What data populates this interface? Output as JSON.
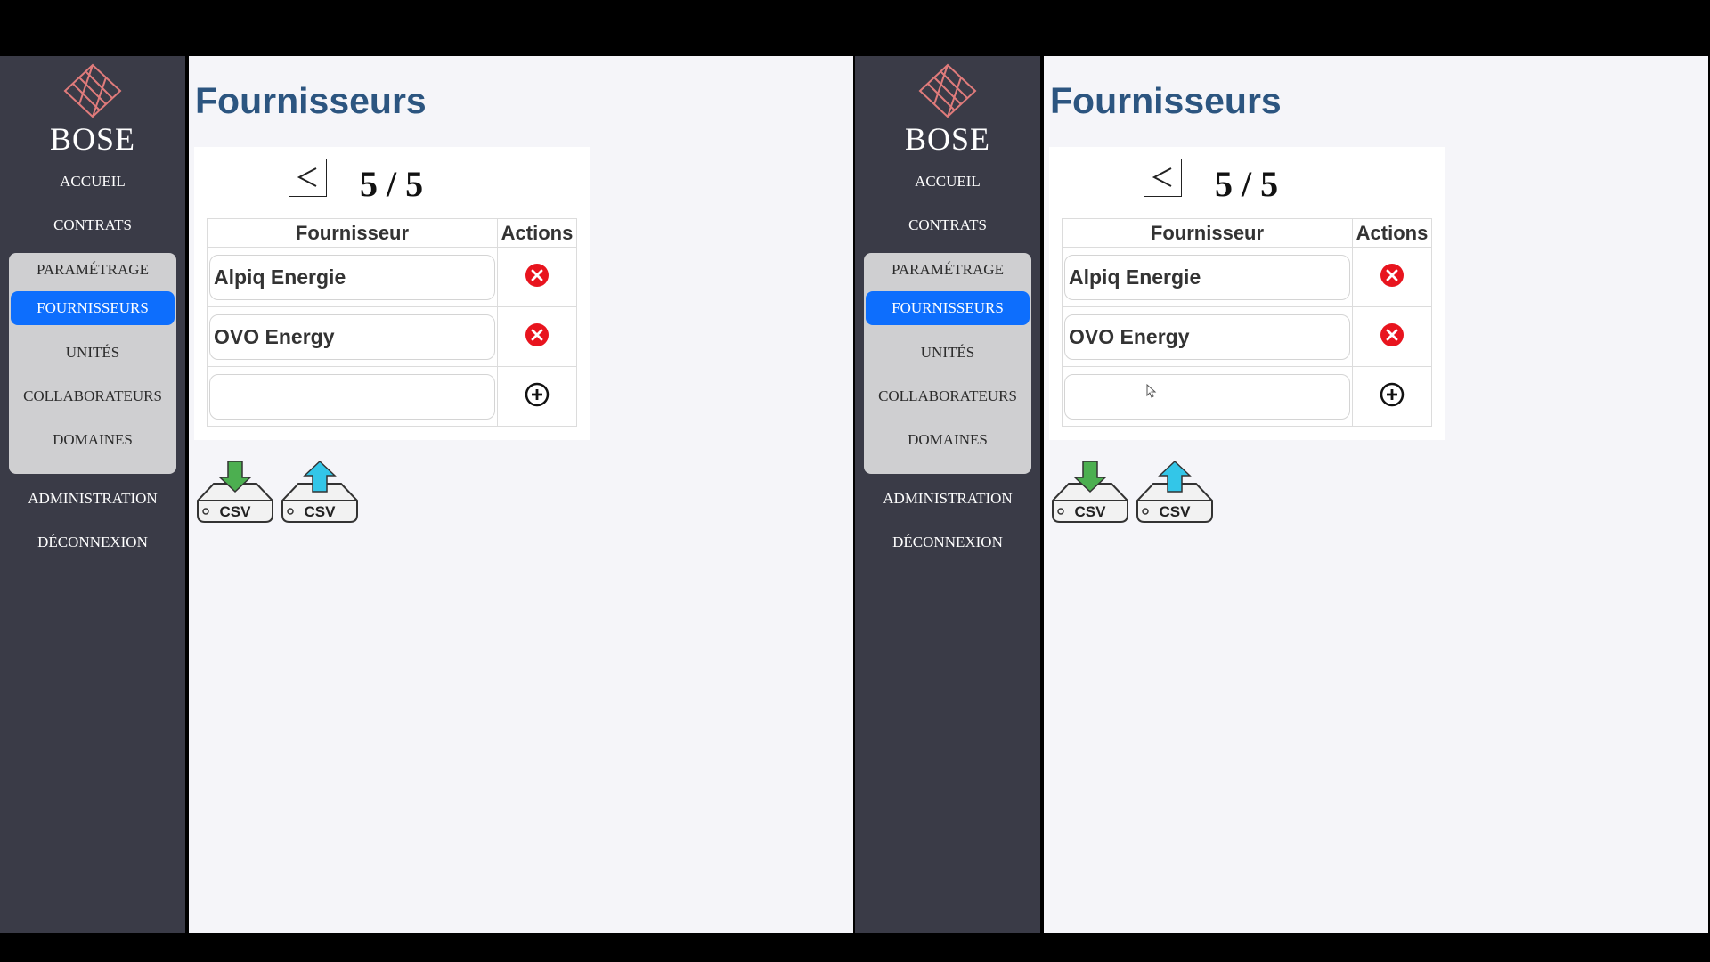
{
  "app": {
    "logo_text": "BOSE"
  },
  "nav": {
    "accueil": "ACCUEIL",
    "contrats": "CONTRATS",
    "parametrage": "PARAMÉTRAGE",
    "fournisseurs": "FOURNISSEURS",
    "unites": "UNITÉS",
    "collaborateurs": "COLLABORATEURS",
    "domaines": "DOMAINES",
    "administration": "ADMINISTRATION",
    "deconnexion": "DÉCONNEXION"
  },
  "page": {
    "title": "Fournisseurs"
  },
  "pager": {
    "prev_symbol": "<",
    "text": "5 / 5"
  },
  "table": {
    "headers": [
      "Fournisseur",
      "Actions"
    ],
    "rows": [
      {
        "name": "Alpiq Energie",
        "action_icon": "delete-icon"
      },
      {
        "name": "OVO Energy",
        "action_icon": "delete-icon"
      }
    ],
    "new_row": {
      "value": "",
      "action_icon": "add-icon"
    }
  },
  "csv": {
    "download_label": "CSV",
    "upload_label": "CSV"
  },
  "colors": {
    "sidebar": "#3a3b47",
    "accent": "#0d6efd",
    "title": "#2c5580",
    "delete": "#e8141e",
    "download_arrow": "#4caf50",
    "upload_arrow": "#33c6e8"
  }
}
